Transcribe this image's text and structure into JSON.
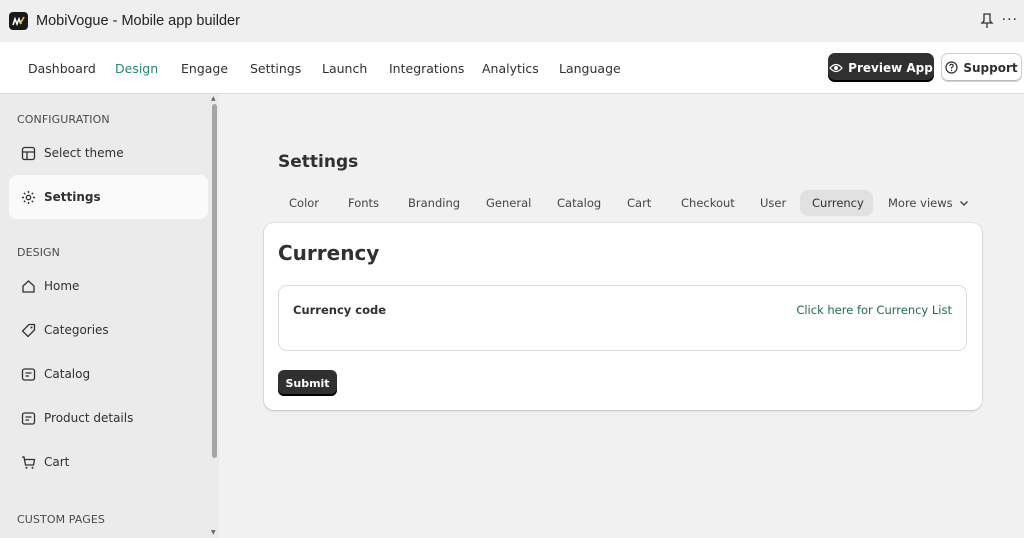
{
  "titlebar": {
    "title": "MobiVogue - Mobile app builder",
    "more": "···"
  },
  "nav": {
    "items": [
      "Dashboard",
      "Design",
      "Engage",
      "Settings",
      "Launch",
      "Integrations",
      "Analytics",
      "Language"
    ],
    "active": "Design",
    "preview_label": "Preview App",
    "support_label": "Support"
  },
  "sidebar": {
    "sections": [
      "CONFIGURATION",
      "DESIGN",
      "CUSTOM PAGES"
    ],
    "config_items": [
      {
        "label": "Select theme",
        "icon": "theme-icon"
      },
      {
        "label": "Settings",
        "icon": "gear-icon",
        "active": true
      }
    ],
    "design_items": [
      {
        "label": "Home",
        "icon": "home-icon"
      },
      {
        "label": "Categories",
        "icon": "tag-icon"
      },
      {
        "label": "Catalog",
        "icon": "catalog-icon"
      },
      {
        "label": "Product details",
        "icon": "product-icon"
      },
      {
        "label": "Cart",
        "icon": "cart-icon"
      }
    ]
  },
  "main": {
    "title": "Settings",
    "tabs": [
      "Color",
      "Fonts",
      "Branding",
      "General",
      "Catalog",
      "Cart",
      "Checkout",
      "User",
      "Currency",
      "More views"
    ],
    "active_tab": "Currency",
    "card": {
      "title": "Currency",
      "field_label": "Currency code",
      "field_link": "Click here for Currency List",
      "submit_label": "Submit"
    }
  },
  "colors": {
    "accent": "#1e8a6e",
    "link": "#1e6b4e",
    "button": "#303030"
  }
}
